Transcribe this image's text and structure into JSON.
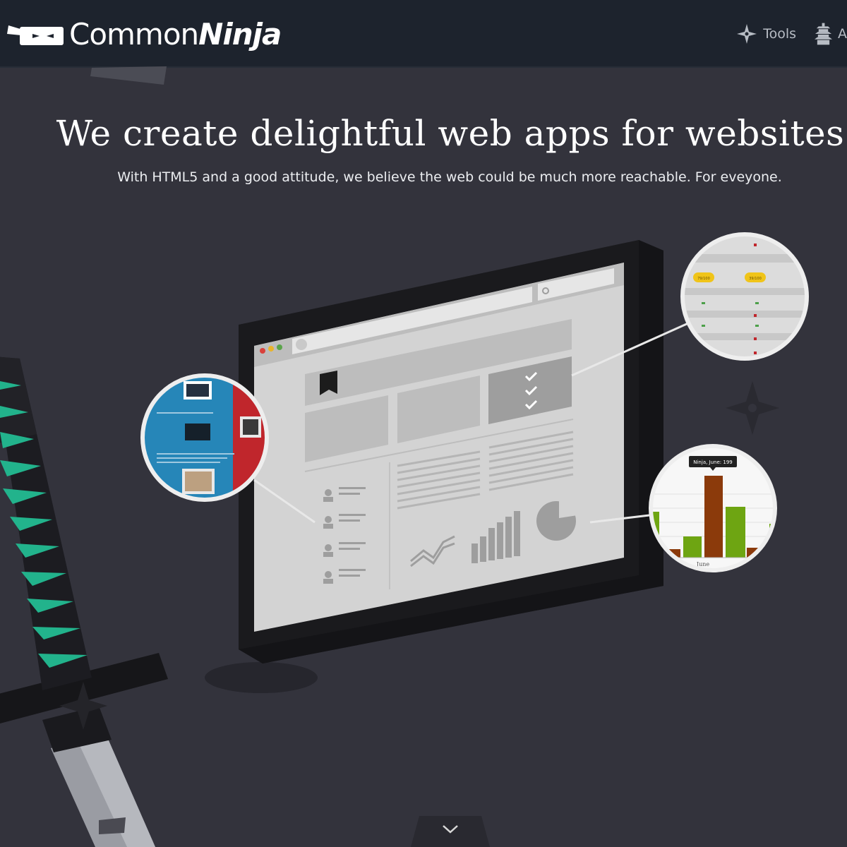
{
  "brand": {
    "name_light": "Common",
    "name_bold": "Ninja"
  },
  "nav": {
    "items": [
      {
        "label": "Tools",
        "icon": "shuriken-icon"
      },
      {
        "label": "A",
        "icon": "pagoda-icon"
      }
    ]
  },
  "hero": {
    "title": "We create delightful web apps for websites",
    "subtitle": "With HTML5 and a good attitude, we believe the web could be much more reachable. For eveyone."
  },
  "illustration": {
    "chart_tooltip": "Ninja, June: 199",
    "chart_axis_label": "June",
    "rating_badge_1": "79/100",
    "rating_badge_2": "39/100"
  },
  "colors": {
    "background": "#33333c",
    "navbar": "#1d232d",
    "katana_accent": "#22b38c",
    "chart_orange": "#8b3a0b",
    "chart_green": "#6ea512"
  },
  "scroll": {
    "icon": "chevron-down-icon"
  }
}
